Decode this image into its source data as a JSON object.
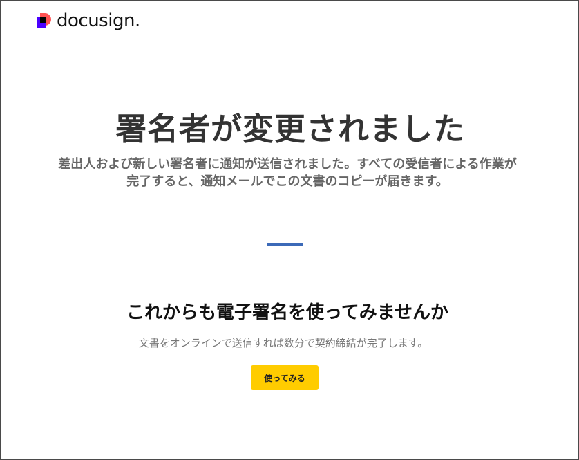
{
  "brand": {
    "name": "docusign",
    "mark_icon": "docusign-logo-mark",
    "colors": {
      "pink": "#ff5252",
      "purple": "#4c00ff",
      "black": "#000000"
    }
  },
  "confirmation": {
    "title": "署名者が変更されました",
    "message": "差出人および新しい署名者に通知が送信されました。すべての受信者による作業が完了すると、通知メールでこの文書のコピーが届きます。"
  },
  "divider_color": "#3c6ab8",
  "promo": {
    "heading": "これからも電子署名を使ってみませんか",
    "text": "文書をオンラインで送信すれば数分で契約締結が完了します。",
    "button_label": "使ってみる",
    "button_color": "#ffcc00"
  }
}
